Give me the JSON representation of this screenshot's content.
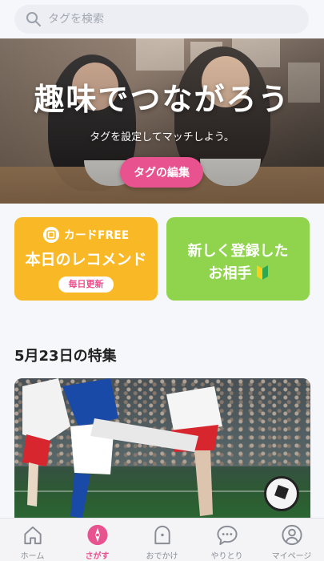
{
  "search": {
    "placeholder": "タグを検索"
  },
  "hero": {
    "title": "趣味でつながろう",
    "subtitle": "タグを設定してマッチしよう。",
    "button_label": "タグの編集"
  },
  "cards": {
    "recommend": {
      "tag": "カードFREE",
      "title": "本日のレコメンド",
      "badge": "毎日更新"
    },
    "new_members": {
      "line1": "新しく登録した",
      "line2": "お相手"
    }
  },
  "feature": {
    "section_title": "5月23日の特集"
  },
  "nav": {
    "items": [
      {
        "label": "ホーム",
        "icon": "home-icon",
        "active": false
      },
      {
        "label": "さがす",
        "icon": "compass-icon",
        "active": true
      },
      {
        "label": "おでかけ",
        "icon": "ghost-icon",
        "active": false
      },
      {
        "label": "やりとり",
        "icon": "chat-icon",
        "active": false
      },
      {
        "label": "マイページ",
        "icon": "user-icon",
        "active": false
      }
    ]
  },
  "colors": {
    "accent": "#e8528f",
    "card_yellow": "#f9b825",
    "card_green": "#8fd44c"
  }
}
